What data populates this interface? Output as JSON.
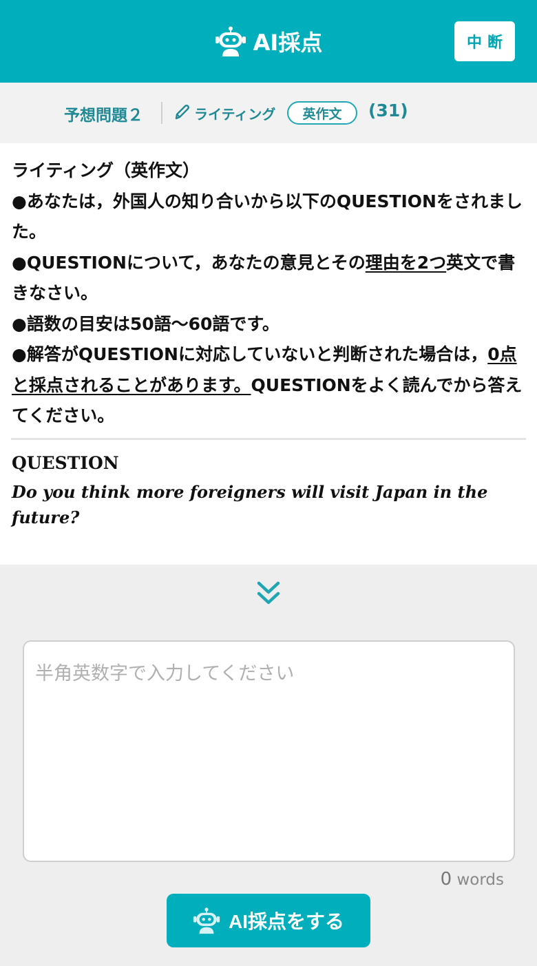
{
  "header": {
    "title": "AI採点",
    "pause_label": "中断"
  },
  "subheader": {
    "question_label": "予想問題２",
    "category": "ライティング",
    "pill": "英作文",
    "count": "(31)"
  },
  "instructions": {
    "title": "ライティング（英作文）",
    "bullet1": "●あなたは，外国人の知り合いから以下のQUESTIONをされました。",
    "bullet2_pre": "●QUESTIONについて，あなたの意見とその",
    "bullet2_u": "理由を2つ",
    "bullet2_post": "英文で書きなさい。",
    "bullet3": "●語数の目安は50語～60語です。",
    "bullet4_pre": "●解答がQUESTIONに対応していないと判断された場合は，",
    "bullet4_u": "0点と採点されることがあります。",
    "bullet4_post": "QUESTIONをよく読んでから答えてください。"
  },
  "question": {
    "label": "QUESTION",
    "text": "Do you think more foreigners will visit Japan in the future?"
  },
  "answer": {
    "placeholder": "半角英数字で入力してください",
    "word_count": "0",
    "word_unit": "words"
  },
  "submit": {
    "label": "AI採点をする"
  },
  "colors": {
    "brand": "#00afbb",
    "accent_text": "#1f8a96"
  },
  "icons": {
    "robot": "robot-icon",
    "pencil": "pencil-icon",
    "chevron": "double-chevron-down-icon"
  }
}
